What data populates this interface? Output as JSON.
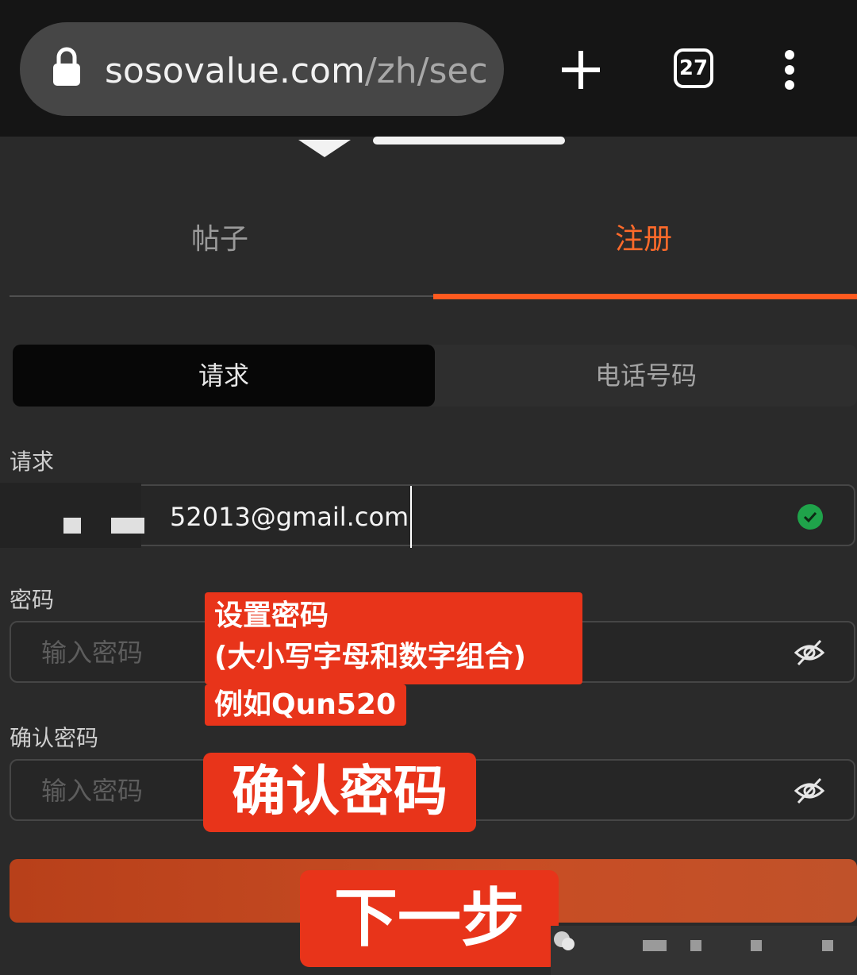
{
  "browser": {
    "url_host": "sosovalue.com",
    "url_path": "/zh/sec",
    "tab_count": "27"
  },
  "tabs": {
    "posts": "帖子",
    "register": "注册"
  },
  "segment": {
    "email": "请求",
    "phone": "电话号码"
  },
  "form": {
    "email_label": "请求",
    "email_value": "52013@gmail.com",
    "password_label": "密码",
    "password_placeholder": "输入密码",
    "confirm_label": "确认密码",
    "confirm_placeholder": "输入密码"
  },
  "annotations": {
    "password_hint_line1": "设置密码",
    "password_hint_line2": "(大小写字母和数字组合)",
    "password_hint_line3": "例如Qun520",
    "confirm_hint": "确认密码",
    "next_hint": "下一步"
  },
  "colors": {
    "accent": "#ff5a1f",
    "annotation": "#e8341a",
    "valid": "#1fa34a"
  }
}
